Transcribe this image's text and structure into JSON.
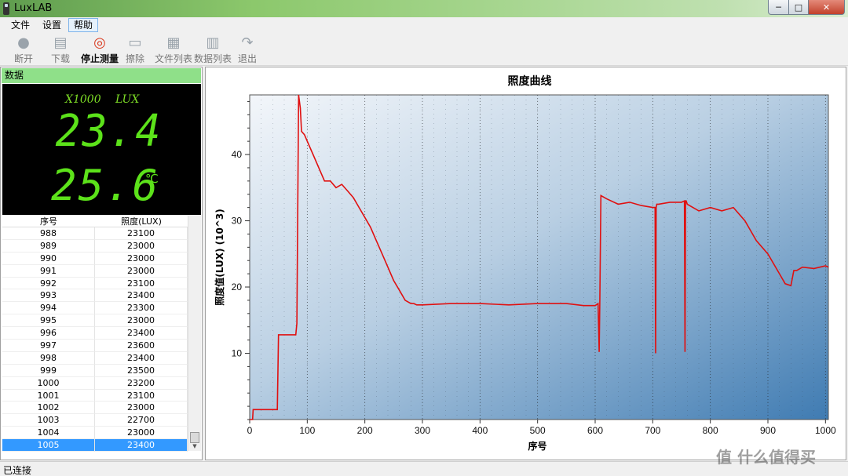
{
  "window": {
    "title": "LuxLAB",
    "min": "─",
    "max": "□",
    "close": "✕"
  },
  "menu": [
    "文件",
    "设置",
    "帮助"
  ],
  "toolbar": [
    {
      "label": "断开",
      "icon": "bulb-icon",
      "enabled": false
    },
    {
      "label": "下载",
      "icon": "download-icon",
      "enabled": false
    },
    {
      "label": "停止测量",
      "icon": "lifebuoy-icon",
      "enabled": true
    },
    {
      "label": "擦除",
      "icon": "erase-icon",
      "enabled": false
    },
    {
      "label": "文件列表",
      "icon": "file-list-icon",
      "enabled": false
    },
    {
      "label": "数据列表",
      "icon": "data-list-icon",
      "enabled": false
    },
    {
      "label": "退出",
      "icon": "exit-icon",
      "enabled": false
    }
  ],
  "panel": {
    "header": "数据"
  },
  "display": {
    "scale": "X1000",
    "unit": "LUX",
    "value": "23.4",
    "temperature": "25.6",
    "temp_unit": "℃"
  },
  "table": {
    "columns": [
      "序号",
      "照度(LUX)"
    ],
    "rows": [
      [
        "988",
        "23100"
      ],
      [
        "989",
        "23000"
      ],
      [
        "990",
        "23000"
      ],
      [
        "991",
        "23000"
      ],
      [
        "992",
        "23100"
      ],
      [
        "993",
        "23400"
      ],
      [
        "994",
        "23300"
      ],
      [
        "995",
        "23000"
      ],
      [
        "996",
        "23400"
      ],
      [
        "997",
        "23600"
      ],
      [
        "998",
        "23400"
      ],
      [
        "999",
        "23500"
      ],
      [
        "1000",
        "23200"
      ],
      [
        "1001",
        "23100"
      ],
      [
        "1002",
        "23000"
      ],
      [
        "1003",
        "22700"
      ],
      [
        "1004",
        "23000"
      ],
      [
        "1005",
        "23400"
      ]
    ],
    "selected_index": 17
  },
  "status": "已连接",
  "watermark": "值 什么值得买",
  "chart_data": {
    "type": "line",
    "title": "照度曲线",
    "xlabel": "序号",
    "ylabel": "照度值(LUX)  (10^3)",
    "xlim": [
      0,
      1005
    ],
    "ylim": [
      0,
      49
    ],
    "xticks": [
      0,
      100,
      200,
      300,
      400,
      500,
      600,
      700,
      800,
      900,
      1000
    ],
    "yticks": [
      10,
      20,
      30,
      40
    ],
    "color": "#e01010",
    "x": [
      0,
      5,
      6,
      48,
      50,
      80,
      82,
      85,
      88,
      90,
      95,
      100,
      110,
      120,
      130,
      140,
      150,
      160,
      170,
      180,
      190,
      200,
      210,
      220,
      230,
      240,
      250,
      260,
      270,
      280,
      285,
      290,
      300,
      350,
      400,
      450,
      500,
      550,
      580,
      600,
      605,
      607,
      608,
      610,
      620,
      640,
      660,
      680,
      700,
      704,
      705,
      706,
      707,
      710,
      730,
      750,
      755,
      756,
      757,
      758,
      760,
      780,
      800,
      820,
      840,
      860,
      880,
      900,
      920,
      930,
      940,
      945,
      950,
      960,
      980,
      1000,
      1005
    ],
    "y": [
      0,
      0,
      1.5,
      1.5,
      12.8,
      12.8,
      14.5,
      49,
      47,
      43.5,
      43,
      42,
      40,
      38,
      36,
      36,
      35,
      35.5,
      34.5,
      33.5,
      32,
      30.5,
      29,
      27,
      25,
      23,
      21,
      19.5,
      18,
      17.5,
      17.5,
      17.3,
      17.3,
      17.5,
      17.5,
      17.3,
      17.5,
      17.5,
      17.2,
      17.2,
      17.5,
      10.2,
      17.5,
      33.8,
      33.3,
      32.5,
      32.8,
      32.3,
      32.0,
      32,
      10,
      32,
      32.5,
      32.5,
      32.8,
      32.8,
      33,
      10.2,
      33,
      33,
      32.5,
      31.5,
      32,
      31.5,
      32,
      30,
      27,
      25,
      22,
      20.5,
      20.2,
      22.5,
      22.5,
      23,
      22.8,
      23.2,
      23.0
    ]
  }
}
